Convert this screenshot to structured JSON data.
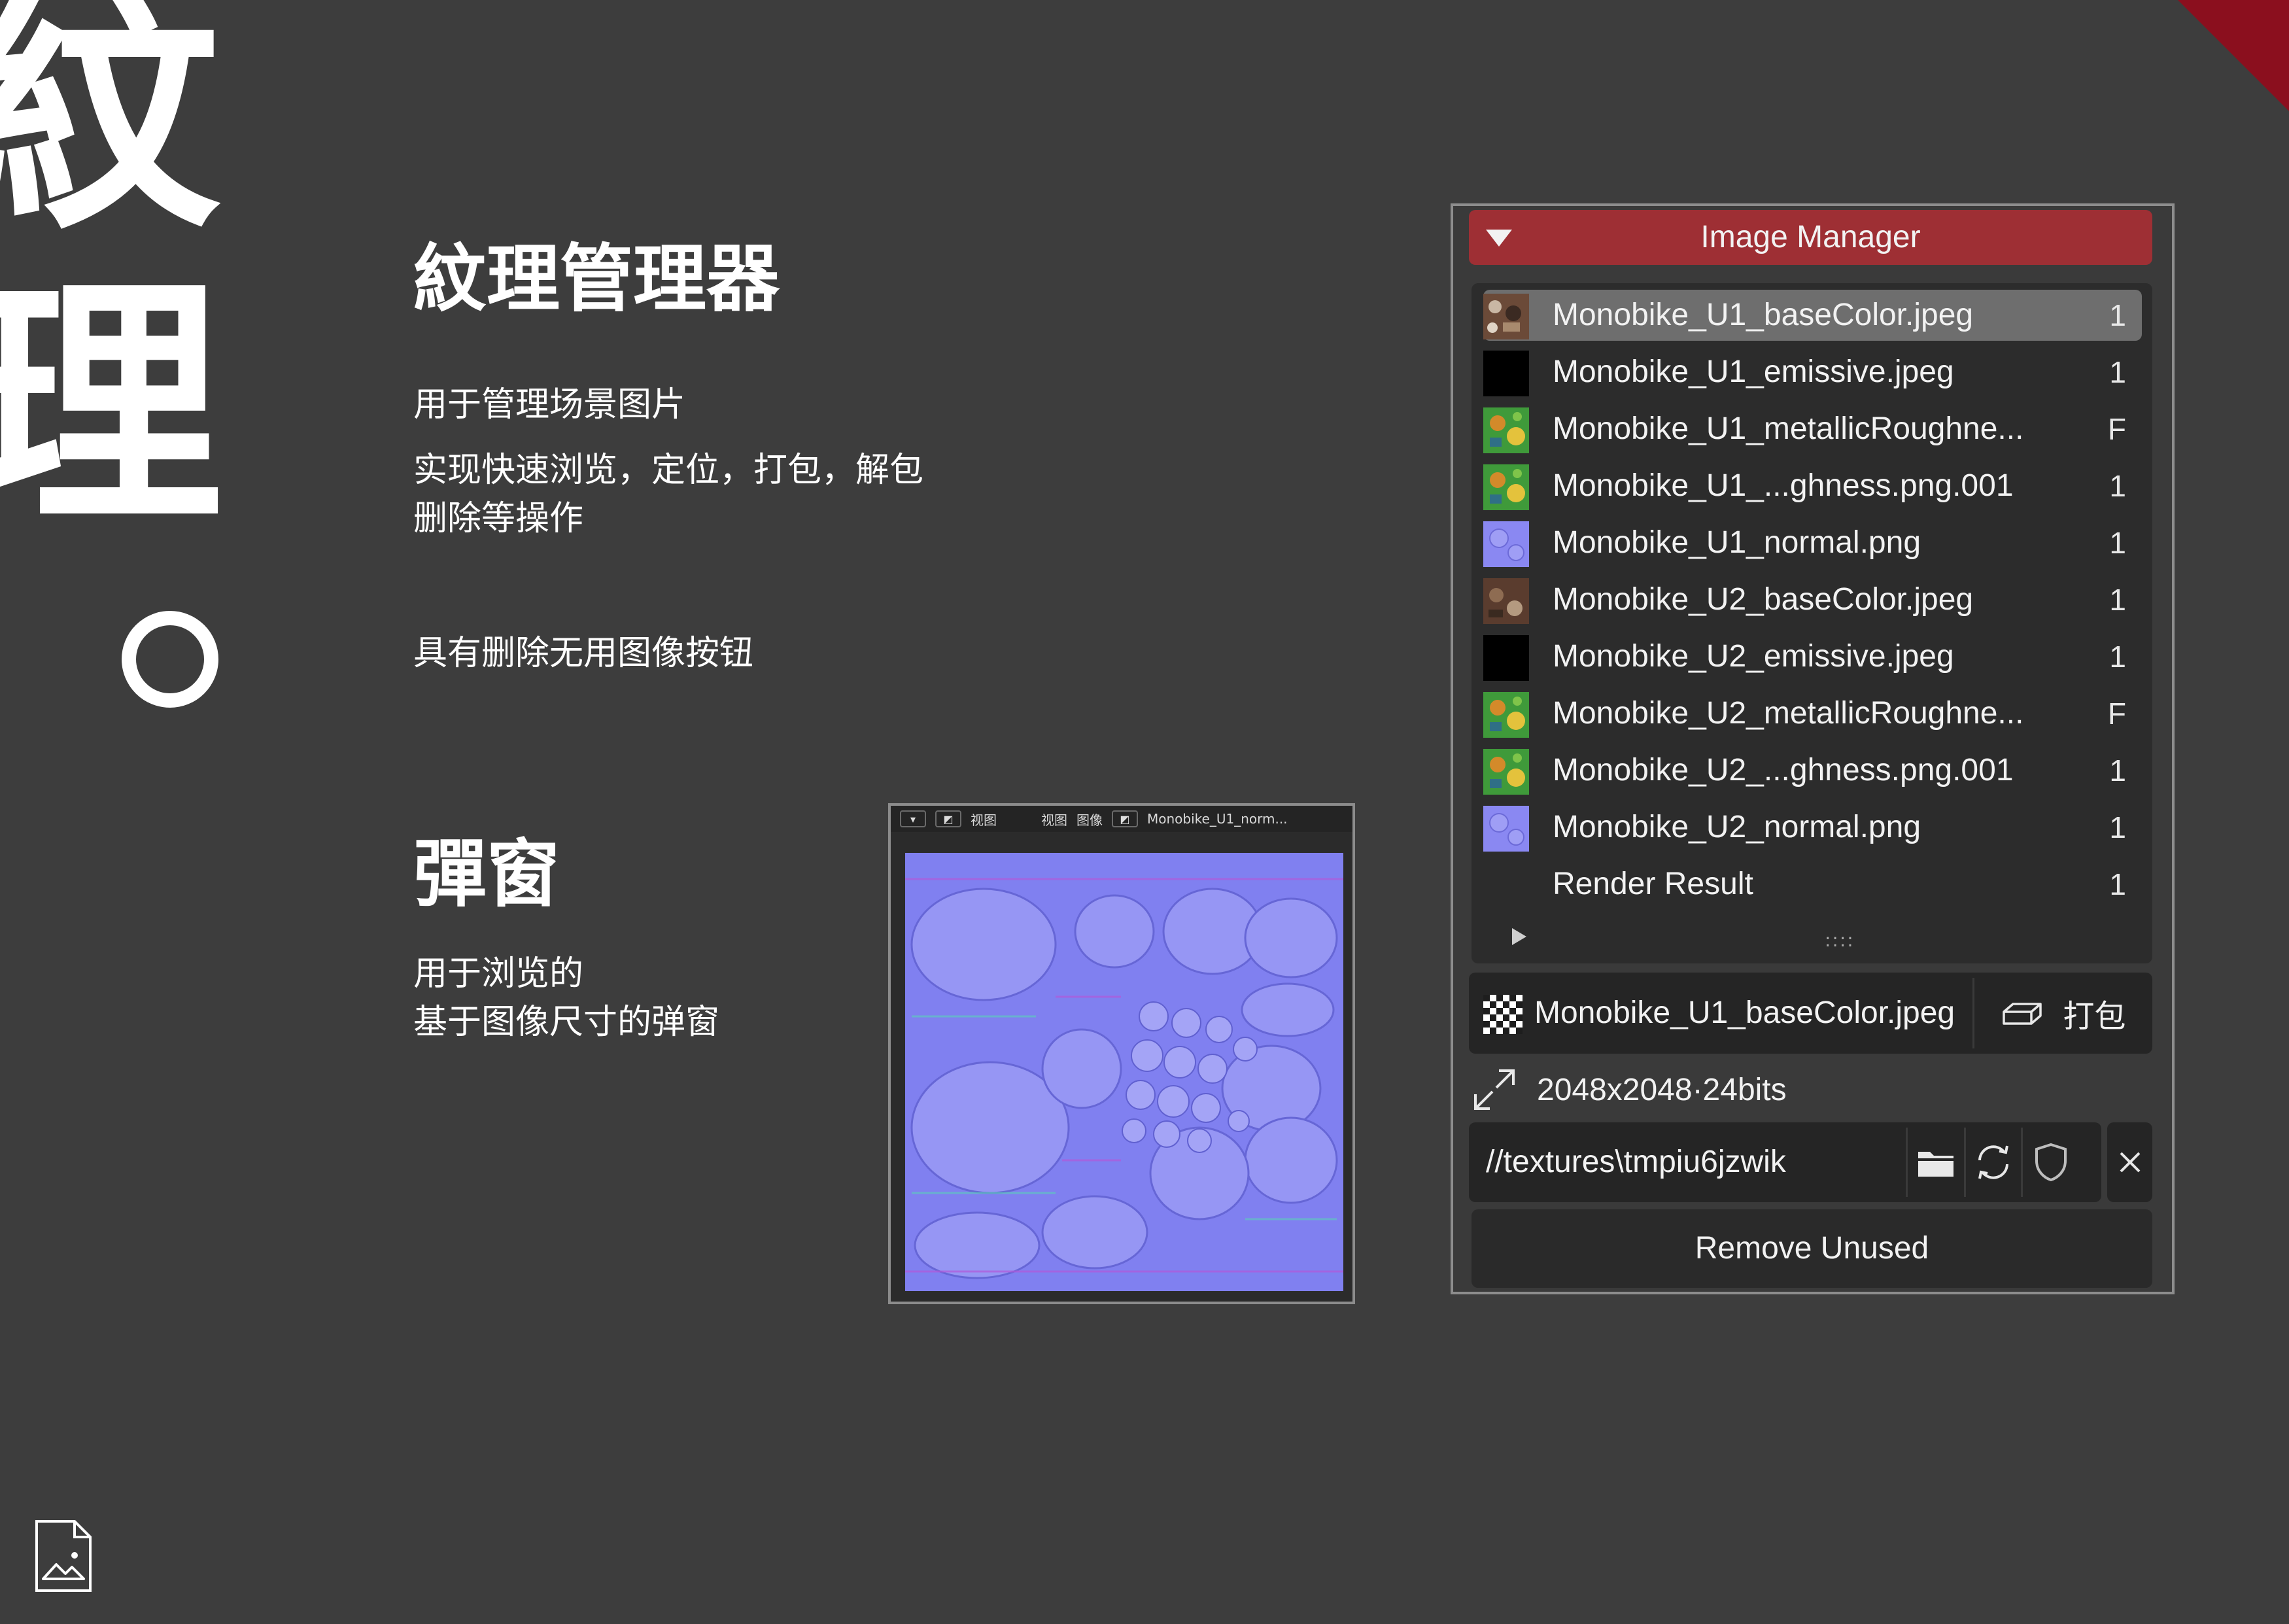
{
  "big_title": {
    "char1": "紋",
    "char2": "理"
  },
  "section1": {
    "heading": "紋理管理器",
    "line1": "用于管理场景图片",
    "line2": "实现快速浏览，定位，打包，解包",
    "line3": "删除等操作",
    "line4": "具有删除无用图像按钮"
  },
  "section2": {
    "heading": "彈窗",
    "line1": "用于浏览的",
    "line2": "基于图像尺寸的弹窗"
  },
  "popup": {
    "view_label": "视图",
    "menu_view": "视图",
    "menu_image": "图像",
    "image_name": "Monobike_U1_norm..."
  },
  "panel": {
    "title": "Image Manager",
    "items": [
      {
        "name": "Monobike_U1_baseColor.jpeg",
        "count": "1",
        "thumb": "base",
        "selected": true
      },
      {
        "name": "Monobike_U1_emissive.jpeg",
        "count": "1",
        "thumb": "black"
      },
      {
        "name": "Monobike_U1_metallicRoughne...",
        "count": "F",
        "thumb": "metal"
      },
      {
        "name": "Monobike_U1_...ghness.png.001",
        "count": "1",
        "thumb": "metal"
      },
      {
        "name": "Monobike_U1_normal.png",
        "count": "1",
        "thumb": "normal"
      },
      {
        "name": "Monobike_U2_baseColor.jpeg",
        "count": "1",
        "thumb": "base2"
      },
      {
        "name": "Monobike_U2_emissive.jpeg",
        "count": "1",
        "thumb": "black"
      },
      {
        "name": "Monobike_U2_metallicRoughne...",
        "count": "F",
        "thumb": "metal"
      },
      {
        "name": "Monobike_U2_...ghness.png.001",
        "count": "1",
        "thumb": "metal"
      },
      {
        "name": "Monobike_U2_normal.png",
        "count": "1",
        "thumb": "normal"
      },
      {
        "name": "Render Result",
        "count": "1",
        "thumb": "none"
      }
    ],
    "grip": "::::",
    "selected_image": "Monobike_U1_baseColor.jpeg",
    "pack_label": "打包",
    "resolution": "2048x2048·24bits",
    "filepath": "//textures\\tmpiu6jzwik",
    "remove_label": "Remove Unused"
  },
  "colors": {
    "background": "#3d3d3d",
    "header_red": "#9e2f34",
    "corner_red": "#8b0f1e",
    "normal_map": "#8080f0"
  }
}
